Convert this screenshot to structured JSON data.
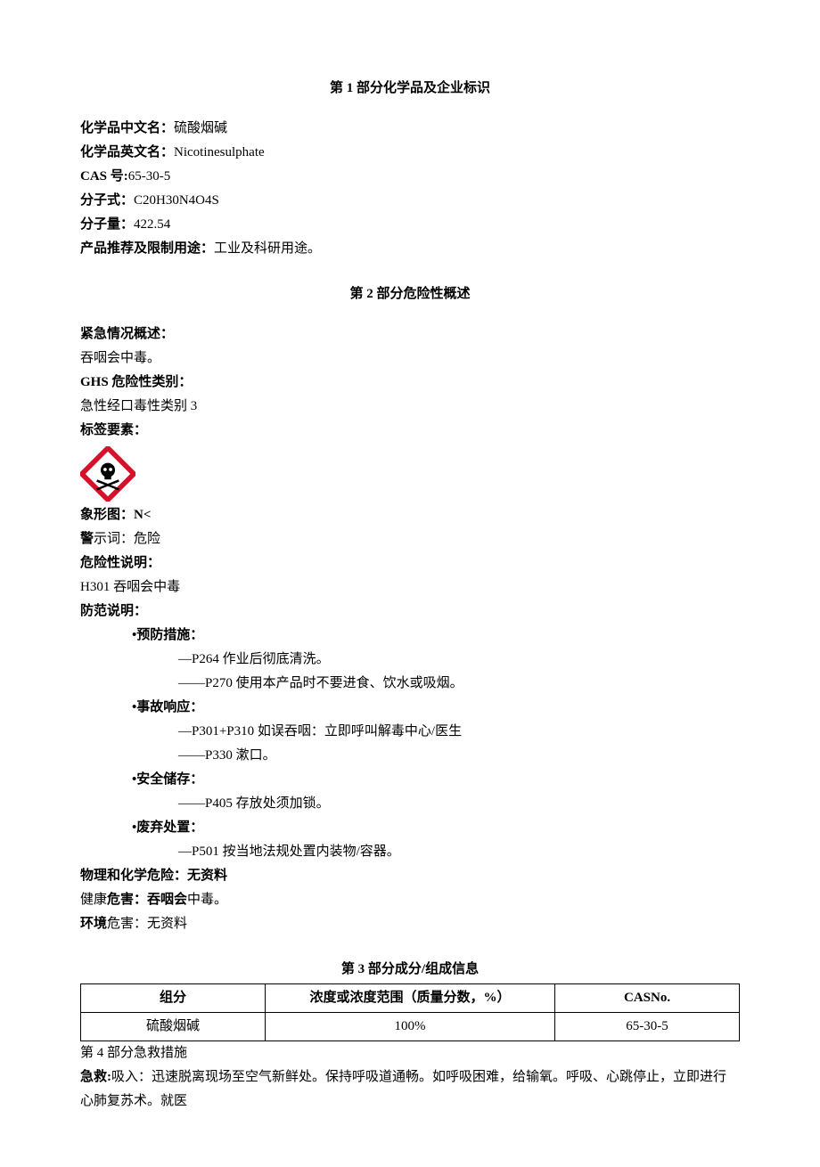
{
  "section1": {
    "title": "第 1 部分化学品及企业标识",
    "fields": {
      "cnNameLabel": "化学品中文名：",
      "cnName": "硫酸烟碱",
      "enNameLabel": "化学品英文名：",
      "enName": "Nicotinesulphate",
      "casLabel": "CAS 号:",
      "cas": "65-30-5",
      "formulaLabel": "分子式：",
      "formula": "C20H30N4O4S",
      "mwLabel": "分子量：",
      "mw": "422.54",
      "useLabel": "产品推荐及限制用途：",
      "use": "工业及科研用途。"
    }
  },
  "section2": {
    "title": "第 2 部分危险性概述",
    "emergencyLabel": "紧急情况概述：",
    "emergencyText": "吞咽会中毒。",
    "ghsLabel": "GHS 危险性类别：",
    "ghsText": "急性经口毒性类别 3",
    "tagLabel": "标签要素：",
    "pictLabel": "象形图：",
    "pictValue": "N<",
    "signalLabel": "警",
    "signalLabel2": "示词：",
    "signalValue": "危险",
    "hazardStmtLabel": "危险性说明：",
    "hazardStmt": "H301 吞咽会中毒",
    "precautionLabel": "防范说明：",
    "groups": {
      "prevent": {
        "title": "•预防措施：",
        "items": [
          "—P264 作业后彻底清洗。",
          "——P270 使用本产品时不要进食、饮水或吸烟。"
        ]
      },
      "response": {
        "title": "•事故响应：",
        "items": [
          "—P301+P310 如误吞咽：立即呼叫解毒中心/医生",
          "——P330 漱口。"
        ]
      },
      "storage": {
        "title": "•安全储存：",
        "items": [
          "——P405 存放处须加锁。"
        ]
      },
      "disposal": {
        "title": "•废弃处置：",
        "items": [
          "—P501 按当地法规处置内装物/容器。"
        ]
      }
    },
    "physChemLabel": "物理和化学危险：",
    "physChemValue": "无资料",
    "healthPrefix": "健康",
    "healthLabel": "危害：吞咽会",
    "healthValue": "中毒。",
    "envLabel": "环境",
    "envLabel2": "危害：",
    "envValue": "无资料"
  },
  "section3": {
    "title": "第 3 部分成分/组成信息",
    "headers": [
      "组分",
      "浓度或浓度范围（质量分数，%）",
      "CASNo."
    ],
    "row": [
      "硫酸烟碱",
      "100%",
      "65-30-5"
    ]
  },
  "section4": {
    "title": "第 4 部分急救措施",
    "firstAidLabel": "急救:",
    "firstAidRoute": "吸入：",
    "firstAidText": "迅速脱离现场至空气新鲜处。保持呼吸道通畅。如呼吸困难，给输氧。呼吸、心跳停止，立即进行心肺复苏术。就医"
  }
}
